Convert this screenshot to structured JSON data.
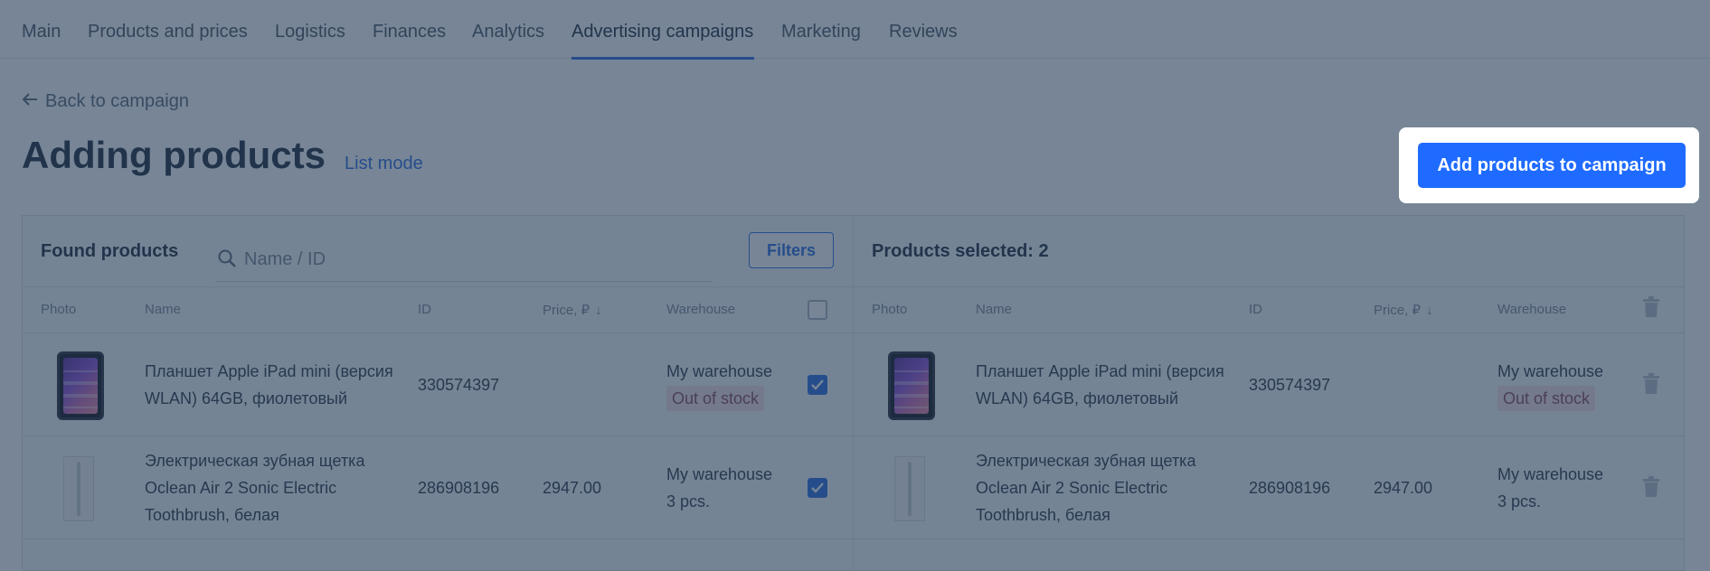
{
  "nav": {
    "tabs": [
      {
        "label": "Main"
      },
      {
        "label": "Products and prices"
      },
      {
        "label": "Logistics"
      },
      {
        "label": "Finances"
      },
      {
        "label": "Analytics"
      },
      {
        "label": "Advertising campaigns",
        "active": true
      },
      {
        "label": "Marketing"
      },
      {
        "label": "Reviews"
      }
    ]
  },
  "back_link": {
    "label": "Back to campaign"
  },
  "page": {
    "title": "Adding products",
    "list_mode_label": "List mode"
  },
  "cta": {
    "label": "Add products to campaign"
  },
  "found": {
    "title": "Found products",
    "search_placeholder": "Name / ID",
    "filters_label": "Filters",
    "columns": {
      "photo": "Photo",
      "name": "Name",
      "id": "ID",
      "price": "Price, ₽",
      "warehouse": "Warehouse"
    },
    "rows": [
      {
        "name": "Планшет Apple iPad mini (версия WLAN) 64GB, фиолетовый",
        "id": "330574397",
        "price": "",
        "warehouse": "My warehouse",
        "stock": "Out of stock",
        "stock_out": true,
        "checked": true,
        "thumb": "ipad-image"
      },
      {
        "name": "Электрическая зубная щетка Oclean Air 2 Sonic Electric Toothbrush, белая",
        "id": "286908196",
        "price": "2947.00",
        "warehouse": "My warehouse",
        "stock": "3 pcs.",
        "stock_out": false,
        "checked": true,
        "thumb": "toothbrush-image"
      }
    ]
  },
  "selected": {
    "title": "Products selected: 2",
    "columns": {
      "photo": "Photo",
      "name": "Name",
      "id": "ID",
      "price": "Price, ₽",
      "warehouse": "Warehouse"
    },
    "rows": [
      {
        "name": "Планшет Apple iPad mini (версия WLAN) 64GB, фиолетовый",
        "id": "330574397",
        "price": "",
        "warehouse": "My warehouse",
        "stock": "Out of stock",
        "stock_out": true,
        "thumb": "ipad-image"
      },
      {
        "name": "Электрическая зубная щетка Oclean Air 2 Sonic Electric Toothbrush, белая",
        "id": "286908196",
        "price": "2947.00",
        "warehouse": "My warehouse",
        "stock": "3 pcs.",
        "stock_out": false,
        "thumb": "toothbrush-image"
      }
    ]
  },
  "icons": {
    "back": "arrow-left-icon",
    "search": "search-icon",
    "sort": "arrow-down-icon",
    "delete": "trash-icon",
    "check": "checkmark-icon"
  },
  "colors": {
    "accent": "#1f6bff",
    "overlay": "#233a56",
    "out_of_stock_bg": "#f6dfe4"
  }
}
